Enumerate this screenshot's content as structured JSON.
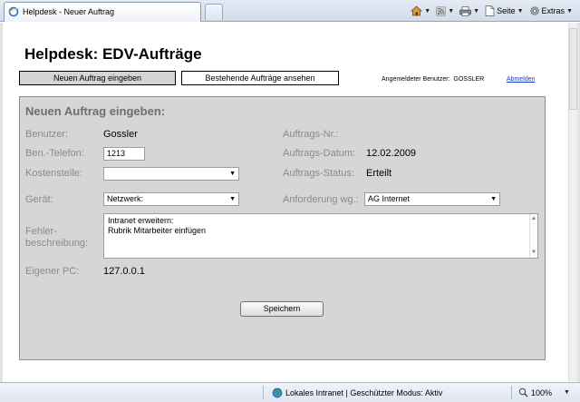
{
  "browser": {
    "tab_title": "Helpdesk - Neuer Auftrag",
    "commands": {
      "page_label": "Seite",
      "tools_label": "Extras"
    },
    "status": {
      "zone_text": "Lokales Intranet | Geschützter Modus: Aktiv",
      "zoom": "100%"
    }
  },
  "page": {
    "title": "Helpdesk: EDV-Aufträge",
    "nav": {
      "new_order": "Neuen Auftrag eingeben",
      "existing_orders": "Bestehende Aufträge ansehen"
    },
    "user_label": "Angemeldeter Benutzer:",
    "user_name": "GOSSLER",
    "logout": "Abmelden"
  },
  "form": {
    "heading": "Neuen Auftrag eingeben:",
    "user": {
      "label": "Benutzer:",
      "value": "Gossler"
    },
    "phone": {
      "label": "Ben.-Telefon:",
      "value": "1213"
    },
    "cost_center": {
      "label": "Kostenstelle:",
      "value": ""
    },
    "device": {
      "label": "Gerät:",
      "value": "Netzwerk:"
    },
    "description": {
      "label_line1": "Fehler-",
      "label_line2": "beschreibung:",
      "line1": "Intranet erweitern:",
      "line2": "Rubrik Mitarbeiter einfügen"
    },
    "own_pc": {
      "label": "Eigener PC:",
      "value": "127.0.0.1"
    },
    "order_no": {
      "label": "Auftrags-Nr.:",
      "value": ""
    },
    "order_date": {
      "label": "Auftrags-Datum:",
      "value": "12.02.2009"
    },
    "order_status": {
      "label": "Auftrags-Status:",
      "value": "Erteilt"
    },
    "request_by": {
      "label": "Anforderung wg.:",
      "value": "AG Internet"
    },
    "save": "Speichern"
  }
}
